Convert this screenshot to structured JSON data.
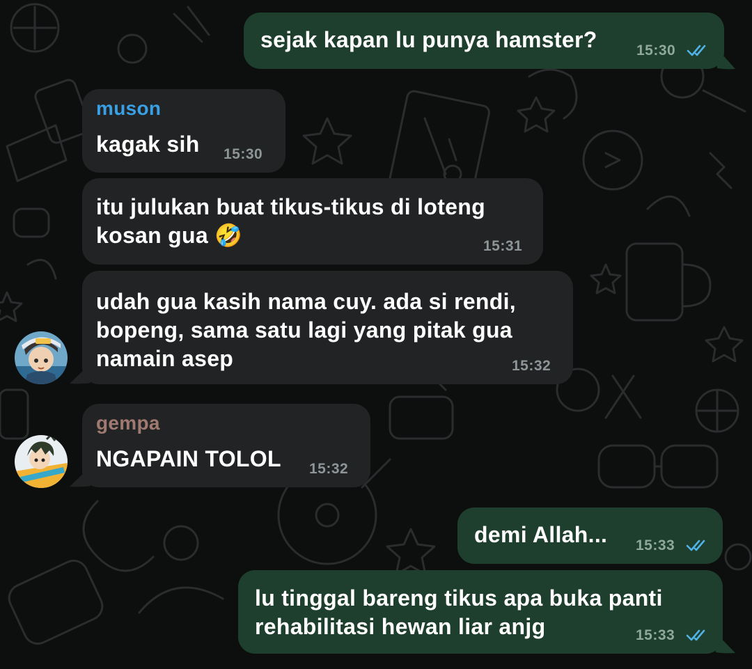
{
  "messages": [
    {
      "sender": "",
      "text": "sejak kapan lu punya hamster?",
      "time": "15:30",
      "direction": "outgoing",
      "read": true
    },
    {
      "sender": "muson",
      "text": "kagak sih",
      "time": "15:30",
      "direction": "incoming"
    },
    {
      "sender": "",
      "text": "itu julukan buat tikus-tikus di loteng\nkosan gua 🤣",
      "time": "15:31",
      "direction": "incoming"
    },
    {
      "sender": "",
      "text": "udah gua kasih nama cuy. ada si rendi,\nbopeng, sama satu lagi yang pitak gua\nnamain asep",
      "time": "15:32",
      "direction": "incoming"
    },
    {
      "sender": "gempa",
      "text": "NGAPAIN TOLOL",
      "time": "15:32",
      "direction": "incoming"
    },
    {
      "sender": "",
      "text": "demi Allah...",
      "time": "15:33",
      "direction": "outgoing",
      "read": true
    },
    {
      "sender": "",
      "text": "lu tinggal bareng tikus apa buka panti\nrehabilitasi hewan liar anjg",
      "time": "15:33",
      "direction": "outgoing",
      "read": true
    }
  ],
  "colors": {
    "muson_name": "#3aa0e6",
    "gempa_name": "#a07a70",
    "read_ticks": "#4fb3e8",
    "incoming_bubble": "#212324",
    "outgoing_bubble": "#1e3f2e"
  },
  "icons": {
    "read_receipt": "double-check-icon",
    "avatar_muson": "avatar-anime-boy-cap",
    "avatar_gempa": "avatar-anime-boy-yellow"
  }
}
